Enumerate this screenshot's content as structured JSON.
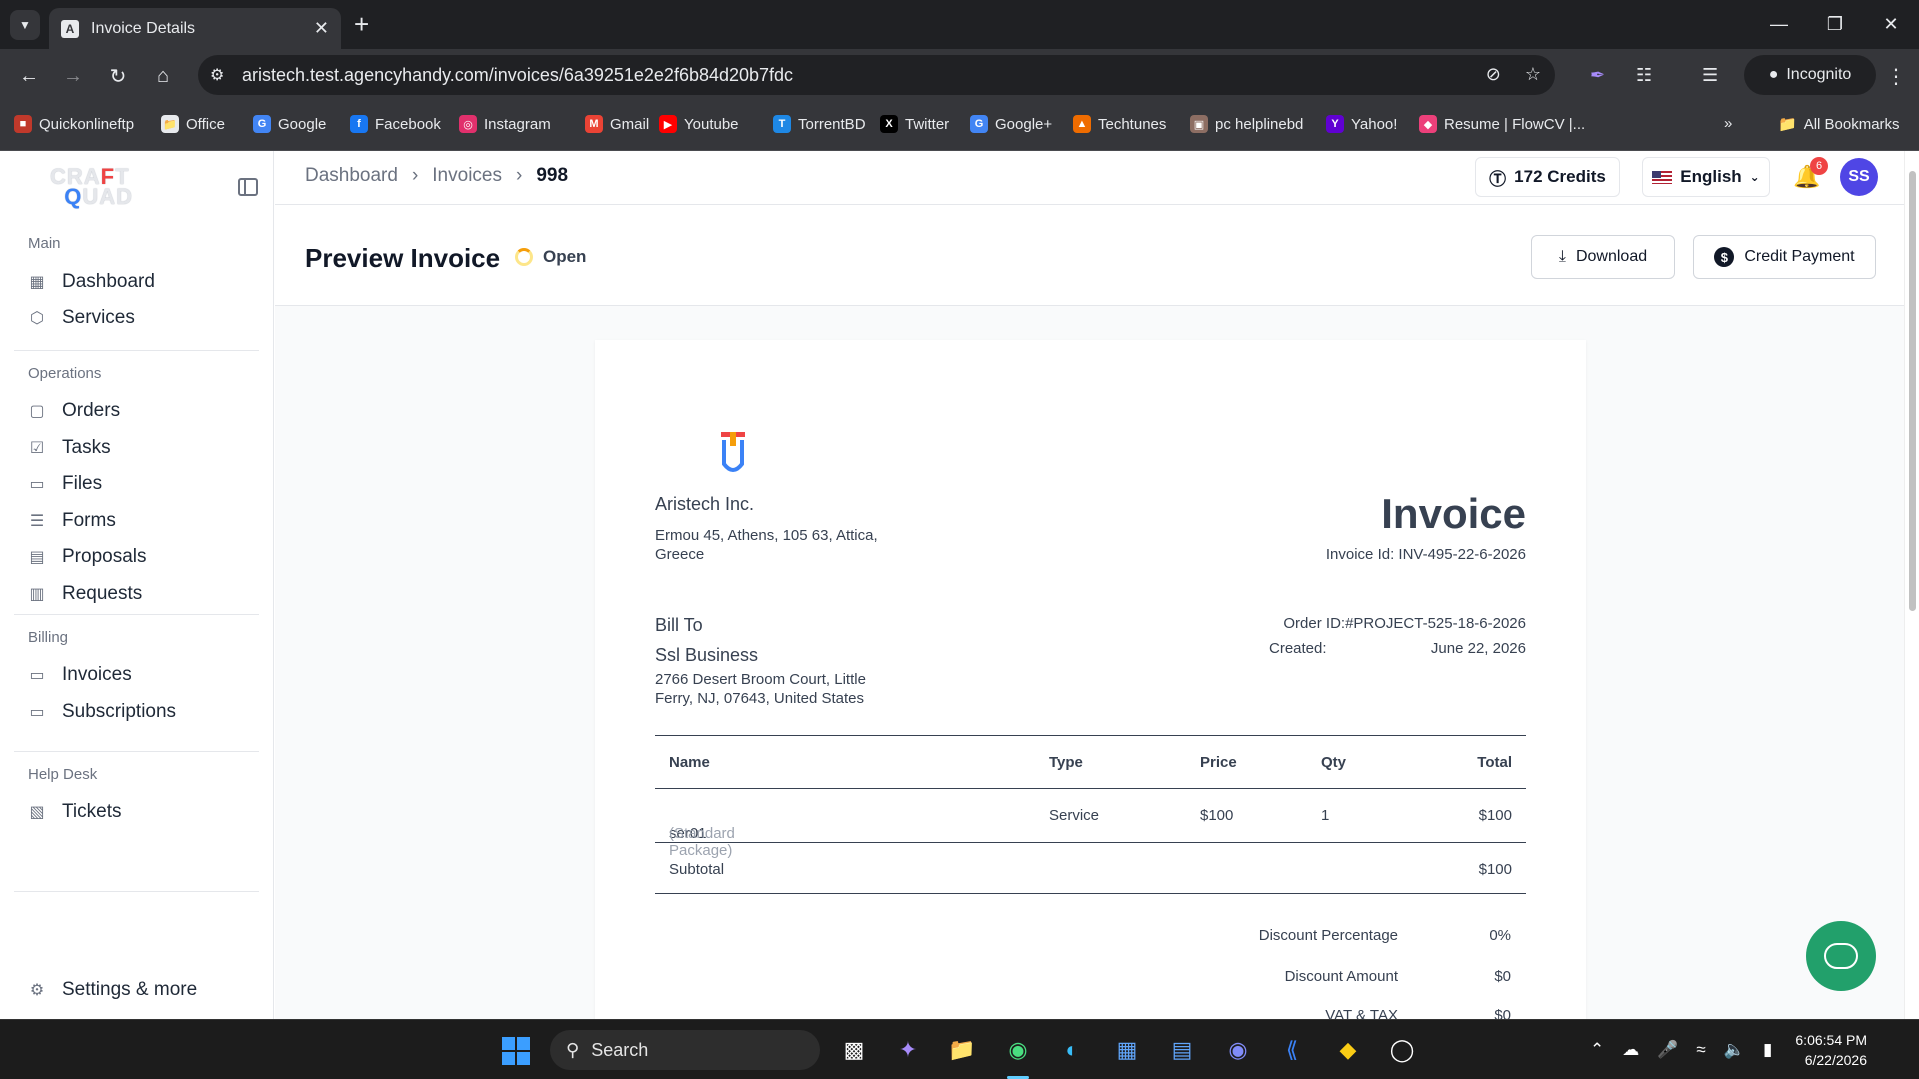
{
  "browser": {
    "tab_title": "Invoice Details",
    "url": "aristech.test.agencyhandy.com/invoices/6a39251e2e2f6b84d20b7fdc",
    "incognito_label": "Incognito",
    "bookmarks": [
      {
        "label": "Quickonlineftp",
        "icon": "bookmark-icon",
        "color": "#c0392b"
      },
      {
        "label": "Office",
        "icon": "folder-icon",
        "color": "#e8eaed"
      },
      {
        "label": "Google",
        "icon": "google-icon",
        "color": "#4285f4"
      },
      {
        "label": "Facebook",
        "icon": "facebook-icon",
        "color": "#1877f2"
      },
      {
        "label": "Instagram",
        "icon": "instagram-icon",
        "color": "#e1306c"
      },
      {
        "label": "Gmail",
        "icon": "gmail-icon",
        "color": "#ea4335"
      },
      {
        "label": "Youtube",
        "icon": "youtube-icon",
        "color": "#ff0000"
      },
      {
        "label": "TorrentBD",
        "icon": "torrent-icon",
        "color": "#1e88e5"
      },
      {
        "label": "Twitter",
        "icon": "x-icon",
        "color": "#000000"
      },
      {
        "label": "Google+",
        "icon": "google-icon",
        "color": "#4285f4"
      },
      {
        "label": "Techtunes",
        "icon": "techtunes-icon",
        "color": "#ef6c00"
      },
      {
        "label": "pc helplinebd",
        "icon": "pc-icon",
        "color": "#8d6e63"
      },
      {
        "label": "Yahoo!",
        "icon": "yahoo-icon",
        "color": "#6001d2"
      },
      {
        "label": "Resume | FlowCV |...",
        "icon": "flowcv-icon",
        "color": "#ec407a"
      }
    ],
    "all_bookmarks_label": "All Bookmarks"
  },
  "sidebar": {
    "sections": [
      {
        "label": "Main",
        "items": [
          {
            "label": "Dashboard",
            "icon": "grid-icon"
          },
          {
            "label": "Services",
            "icon": "cube-icon"
          }
        ]
      },
      {
        "label": "Operations",
        "items": [
          {
            "label": "Orders",
            "icon": "bag-icon"
          },
          {
            "label": "Tasks",
            "icon": "checkbox-icon"
          },
          {
            "label": "Files",
            "icon": "folder-icon"
          },
          {
            "label": "Forms",
            "icon": "form-icon"
          },
          {
            "label": "Proposals",
            "icon": "document-icon"
          },
          {
            "label": "Requests",
            "icon": "clipboard-icon"
          }
        ]
      },
      {
        "label": "Billing",
        "items": [
          {
            "label": "Invoices",
            "icon": "card-icon"
          },
          {
            "label": "Subscriptions",
            "icon": "card-icon"
          }
        ]
      },
      {
        "label": "Help Desk",
        "items": [
          {
            "label": "Tickets",
            "icon": "ticket-icon"
          }
        ]
      }
    ],
    "settings_label": "Settings & more"
  },
  "topbar": {
    "breadcrumb": [
      "Dashboard",
      "Invoices",
      "998"
    ],
    "credits": "172 Credits",
    "language": "English",
    "notifications": "6",
    "avatar_initials": "SS"
  },
  "header": {
    "title": "Preview Invoice",
    "status": "Open",
    "download_label": "Download",
    "credit_payment_label": "Credit Payment"
  },
  "invoice": {
    "company_name": "Aristech Inc.",
    "company_address": "Ermou 45, Athens, 105 63, Attica, Greece",
    "title": "Invoice",
    "invoice_id": "Invoice Id: INV-495-22-6-2026",
    "bill_to_label": "Bill To",
    "client_name": "Ssl Business",
    "client_address": "2766 Desert Broom Court, Little Ferry, NJ, 07643, United States",
    "order_id": "Order ID:#PROJECT-525-18-6-2026",
    "created_label": "Created:",
    "created_value": "June 22, 2026",
    "columns": [
      "Name",
      "Type",
      "Price",
      "Qty",
      "Total"
    ],
    "rows": [
      {
        "name": "ser01",
        "package": "(Standard Package)",
        "type": "Service",
        "price": "$100",
        "qty": "1",
        "total": "$100"
      }
    ],
    "subtotal_label": "Subtotal",
    "subtotal_value": "$100",
    "summary": [
      {
        "label": "Discount Percentage",
        "value": "0%"
      },
      {
        "label": "Discount Amount",
        "value": "$0"
      },
      {
        "label": "VAT & TAX",
        "value": "$0"
      }
    ]
  },
  "taskbar": {
    "search_placeholder": "Search",
    "time": "6:06:54 PM",
    "date": "6/22/2026"
  }
}
